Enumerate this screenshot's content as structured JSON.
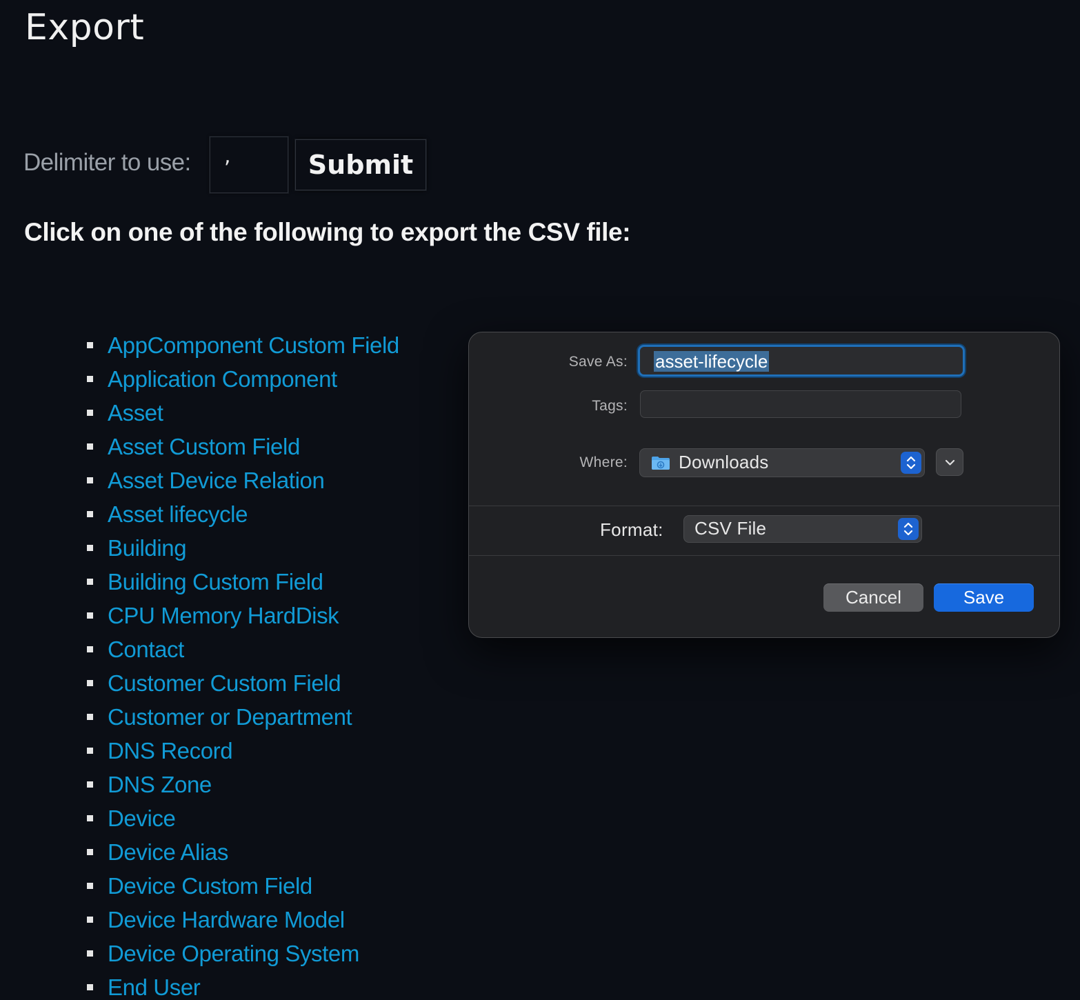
{
  "page": {
    "title": "Export",
    "delimiter_label": "Delimiter to use:",
    "delimiter_value": ",",
    "submit_label": "Submit",
    "instruction": "Click on one of the following to export the CSV file:"
  },
  "export_items": [
    {
      "label": "AppComponent Custom Field"
    },
    {
      "label": "Application Component"
    },
    {
      "label": "Asset"
    },
    {
      "label": "Asset Custom Field"
    },
    {
      "label": "Asset Device Relation"
    },
    {
      "label": "Asset lifecycle"
    },
    {
      "label": "Building"
    },
    {
      "label": "Building Custom Field"
    },
    {
      "label": "CPU Memory HardDisk"
    },
    {
      "label": "Contact"
    },
    {
      "label": "Customer Custom Field"
    },
    {
      "label": "Customer or Department"
    },
    {
      "label": "DNS Record"
    },
    {
      "label": "DNS Zone"
    },
    {
      "label": "Device"
    },
    {
      "label": "Device Alias"
    },
    {
      "label": "Device Custom Field"
    },
    {
      "label": "Device Hardware Model"
    },
    {
      "label": "Device Operating System"
    },
    {
      "label": "End User"
    }
  ],
  "dialog": {
    "save_as_label": "Save As:",
    "save_as_value": "asset-lifecycle",
    "tags_label": "Tags:",
    "tags_value": "",
    "where_label": "Where:",
    "where_value": "Downloads",
    "format_label": "Format:",
    "format_value": "CSV File",
    "cancel_label": "Cancel",
    "save_label": "Save"
  },
  "colors": {
    "background": "#0b0e15",
    "link": "#119bd6",
    "accent": "#1769de"
  },
  "icons": {
    "folder": "downloads-folder-icon",
    "stepper": "up-down-chevron-icon",
    "expand": "chevron-down-icon"
  }
}
